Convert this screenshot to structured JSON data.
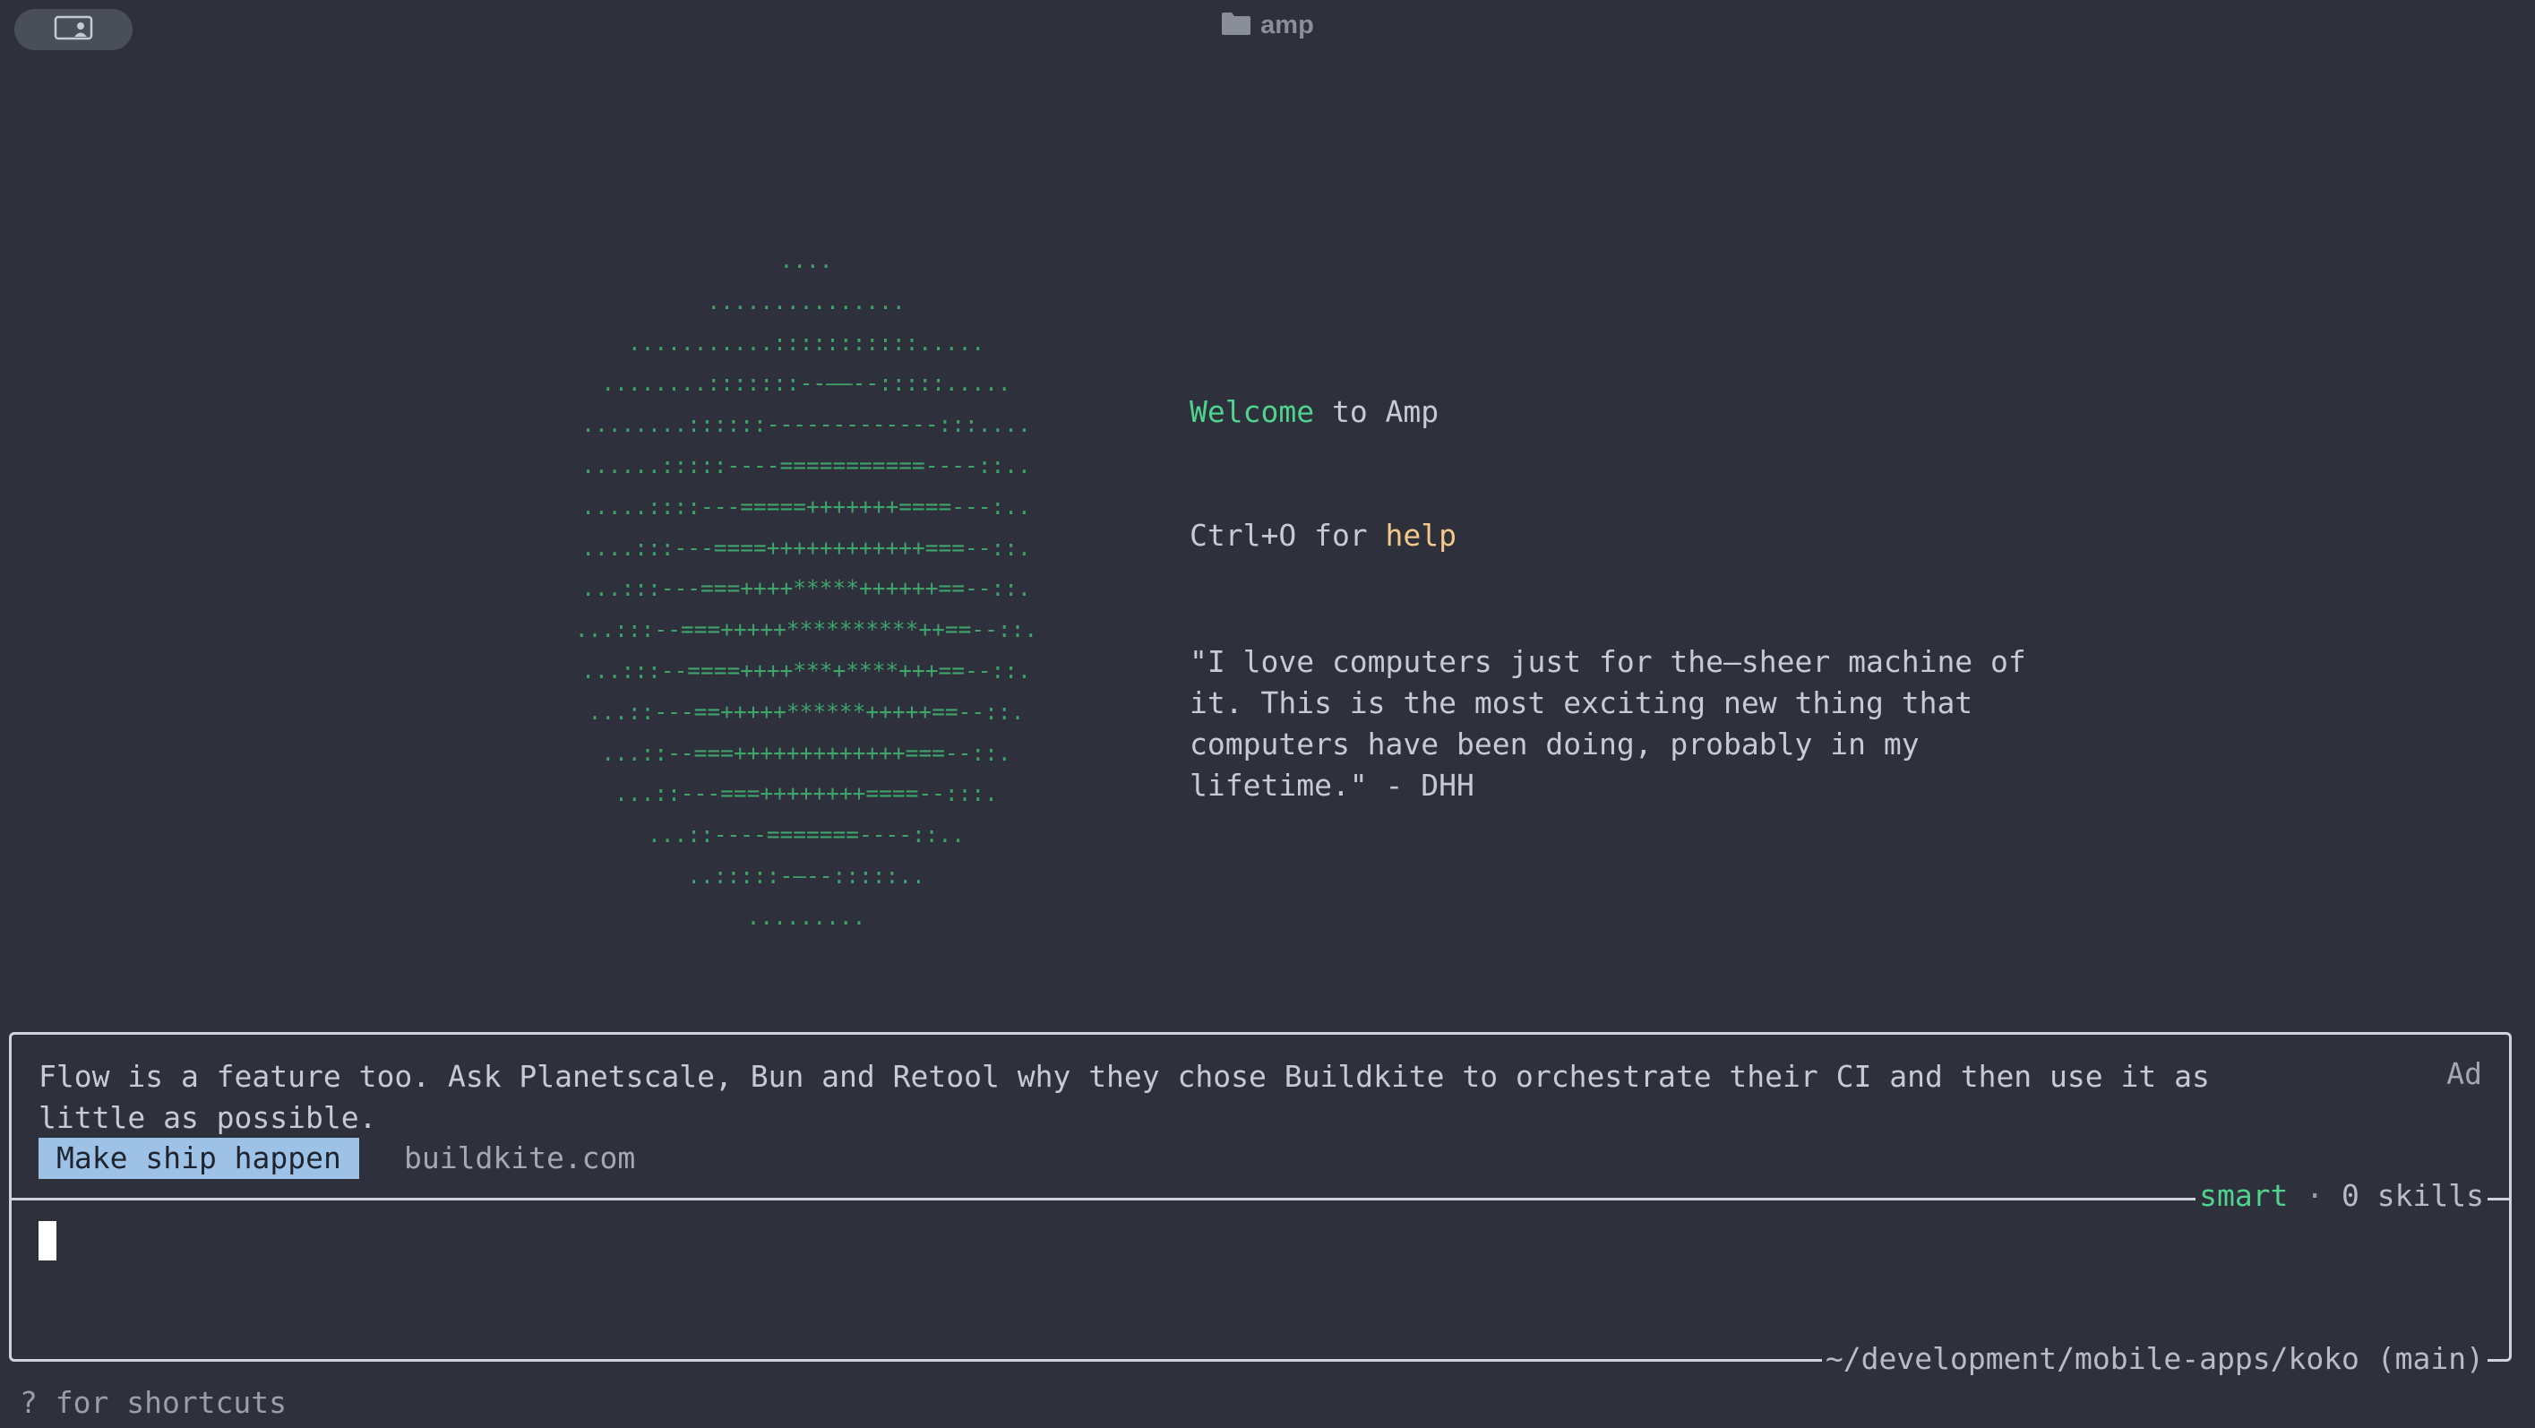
{
  "window": {
    "title": "amp"
  },
  "ascii_art": [
    "....",
    "...............",
    "...........:::::::::::.....",
    "........:::::::--——--:::::.....",
    "........::::::-------------:::....",
    "......:::::----===========----::..",
    ".....::::---=====+++++++====---:..",
    "....:::---====++++++++++++===--::.",
    "...:::---===++++*****++++++==--::.",
    "...:::--===+++++**********++==--::.",
    "...:::--====++++***+****+++==--::.",
    "...::---==+++++******+++++==--::.",
    "...::--===+++++++++++++===--::.",
    "...::---===++++++++====--:::.",
    "...::----=======----::..",
    "..:::::-—--:::::..",
    "........."
  ],
  "welcome": {
    "prefix": "Welcome",
    "suffix": " to Amp"
  },
  "help_line": {
    "prefix": "Ctrl+O for ",
    "keyword": "help"
  },
  "quote": "\"I love computers just for the—sheer machine of\nit. This is the most exciting new thing that\ncomputers have been doing, probably in my\nlifetime.\" - DHH",
  "ad": {
    "text": "Flow is a feature too. Ask Planetscale, Bun and Retool why they chose Buildkite to orchestrate their CI and then use it as little as possible.",
    "label": "Ad",
    "cta": "Make ship happen",
    "domain": "buildkite.com"
  },
  "status": {
    "mode": "smart",
    "separator": "·",
    "skills": "0 skills",
    "path": "~/development/mobile-apps/koko (main)"
  },
  "footer": {
    "shortcuts": "? for shortcuts"
  },
  "colors": {
    "background": "#2e313b",
    "accent_green": "#4fd38e",
    "accent_yellow": "#f3c98a",
    "cta_bg": "#9ec2e6"
  }
}
